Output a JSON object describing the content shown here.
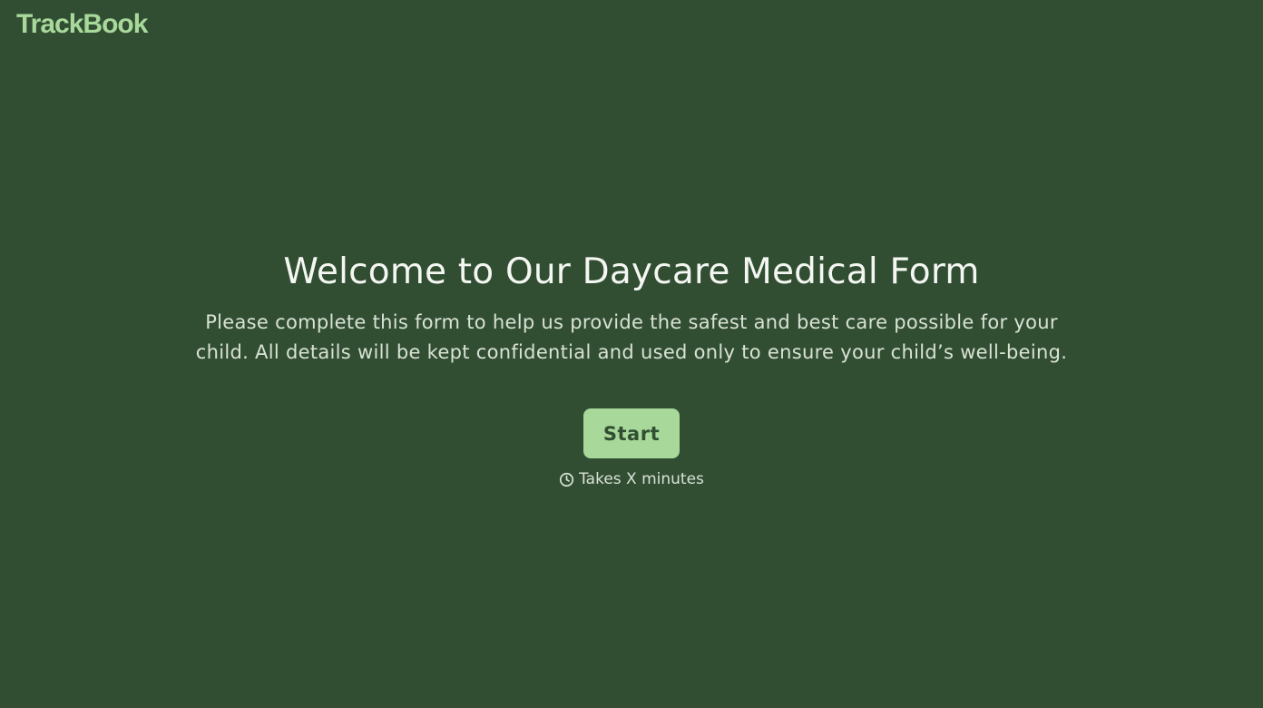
{
  "brand": {
    "name": "TrackBook"
  },
  "welcome": {
    "title": "Welcome to Our Daycare Medical Form",
    "description": "Please complete this form to help us provide the safest and best care possible for your child. All details will be kept confidential and used only to ensure your child’s well-being.",
    "start_label": "Start",
    "duration_text": "Takes X minutes",
    "duration_icon": "clock-icon"
  },
  "colors": {
    "background": "#314e33",
    "accent": "#a8d89a",
    "text": "#f4f7f1"
  }
}
